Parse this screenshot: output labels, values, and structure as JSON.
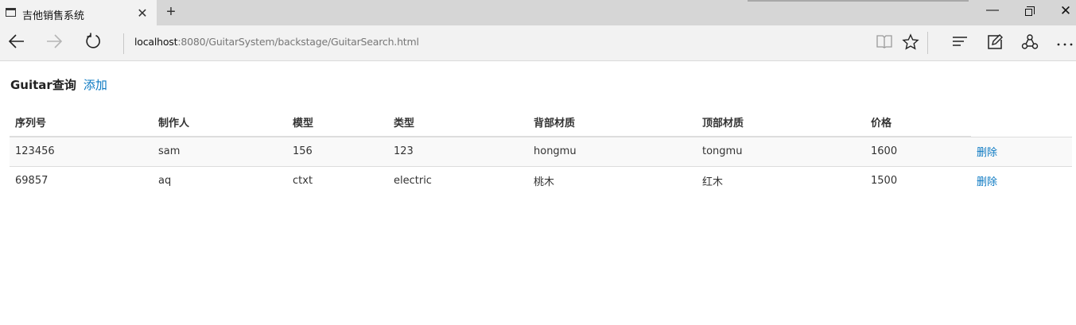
{
  "browser": {
    "tab_title": "吉他销售系统",
    "tab_close": "✕",
    "new_tab": "+",
    "url_host": "localhost",
    "url_rest": ":8080/GuitarSystem/backstage/GuitarSearch.html",
    "window": {
      "minimize": "—",
      "close": "✕"
    },
    "icons": [
      "page-icon",
      "back-arrow-icon",
      "forward-arrow-icon",
      "refresh-icon",
      "reading-view-icon",
      "favorite-star-icon",
      "hub-icon",
      "web-note-icon",
      "share-icon",
      "more-icon"
    ]
  },
  "page": {
    "title": "Guitar查询",
    "add_label": "添加"
  },
  "table": {
    "headers": [
      "序列号",
      "制作人",
      "模型",
      "类型",
      "背部材质",
      "顶部材质",
      "价格",
      ""
    ],
    "rows": [
      {
        "serial": "123456",
        "builder": "sam",
        "model": "156",
        "type": "123",
        "back_wood": "hongmu",
        "top_wood": "tongmu",
        "price": "1600",
        "action": "删除"
      },
      {
        "serial": "69857",
        "builder": "aq",
        "model": "ctxt",
        "type": "electric",
        "back_wood": "桃木",
        "top_wood": "红木",
        "price": "1500",
        "action": "删除"
      }
    ]
  },
  "colors": {
    "link": "#0a78c2",
    "tabbar": "#d6d6d6",
    "toolbar": "#f2f2f2"
  }
}
